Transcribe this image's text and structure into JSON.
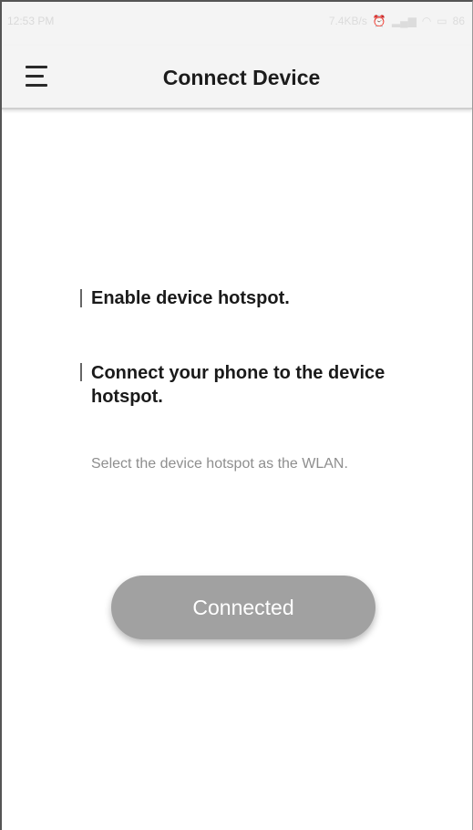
{
  "status_bar": {
    "time": "12:53 PM",
    "network_speed": "7.4KB/s",
    "battery": "86"
  },
  "app_bar": {
    "title": "Connect Device",
    "menu_icon": "hamburger-menu-icon"
  },
  "steps": [
    {
      "text": "Enable device hotspot."
    },
    {
      "text": "Connect your phone to the device hotspot."
    }
  ],
  "hint": "Select the device hotspot as the WLAN.",
  "connect_button": {
    "label": "Connected"
  },
  "colors": {
    "button_bg": "#a1a1a1",
    "title": "#1c1c1c",
    "hint": "#8e8e8e"
  }
}
